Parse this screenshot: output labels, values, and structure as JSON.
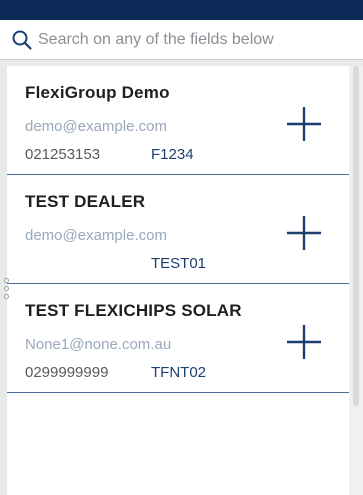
{
  "search": {
    "placeholder": "Search on any of the fields below",
    "value": ""
  },
  "colors": {
    "top_bar": "#0b2a57",
    "divider": "#4a6d96",
    "add_icon": "#1b3f6e"
  },
  "dealers": [
    {
      "name": "FlexiGroup Demo",
      "email": "demo@example.com",
      "phone": "021253153",
      "code": "F1234",
      "add_icon": "plus-icon"
    },
    {
      "name": "TEST DEALER",
      "email": "demo@example.com",
      "phone": "",
      "code": "TEST01",
      "add_icon": "plus-icon"
    },
    {
      "name": "TEST FLEXICHIPS SOLAR",
      "email": "None1@none.com.au",
      "phone": "0299999999",
      "code": "TFNT02",
      "add_icon": "plus-icon"
    }
  ]
}
